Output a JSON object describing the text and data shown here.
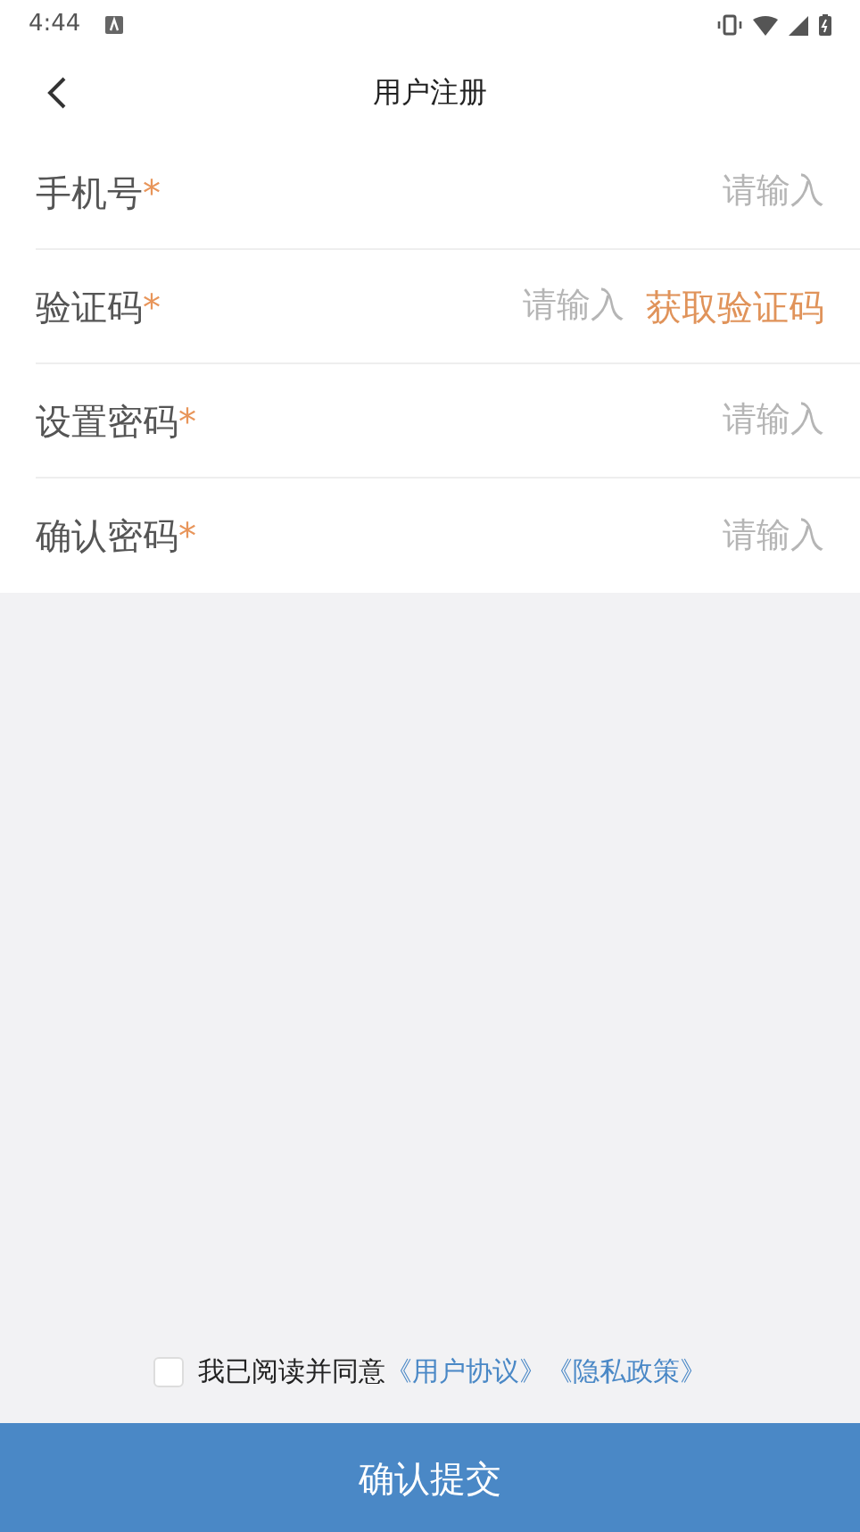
{
  "status_bar": {
    "time": "4:44"
  },
  "header": {
    "title": "用户注册"
  },
  "fields": [
    {
      "kind": "input",
      "label": "手机号",
      "required": "*",
      "placeholder": "请输入"
    },
    {
      "kind": "code",
      "label": "验证码",
      "required": "*",
      "placeholder": "请输入",
      "action": "获取验证码"
    },
    {
      "kind": "input",
      "label": "设置密码",
      "required": "*",
      "placeholder": "请输入"
    },
    {
      "kind": "input",
      "label": "确认密码",
      "required": "*",
      "placeholder": "请输入"
    }
  ],
  "agreement": {
    "checked": false,
    "text": "我已阅读并同意",
    "links": [
      "《用户协议》",
      "《隐私政策》"
    ]
  },
  "submit_button": "确认提交"
}
